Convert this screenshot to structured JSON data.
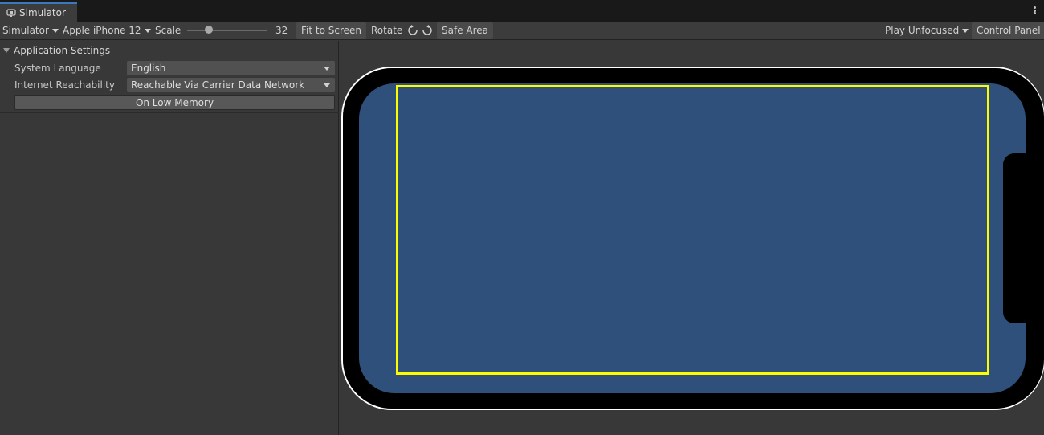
{
  "tab": {
    "title": "Simulator",
    "icon": "simulator-icon"
  },
  "toolbar": {
    "mode_label": "Simulator",
    "device_label": "Apple iPhone 12",
    "scale_label": "Scale",
    "scale_value": "32",
    "fit_label": "Fit to Screen",
    "rotate_label": "Rotate",
    "safe_area_label": "Safe Area",
    "play_mode_label": "Play Unfocused",
    "control_panel_label": "Control Panel"
  },
  "settings": {
    "header": "Application Settings",
    "language_label": "System Language",
    "language_value": "English",
    "reachability_label": "Internet Reachability",
    "reachability_value": "Reachable Via Carrier Data Network",
    "low_memory_label": "On Low Memory"
  },
  "colors": {
    "screen": "#30507c",
    "bezel": "#000000",
    "outline": "#ffffff",
    "safe_area": "#fdfd00",
    "accent": "#3a79bb"
  }
}
